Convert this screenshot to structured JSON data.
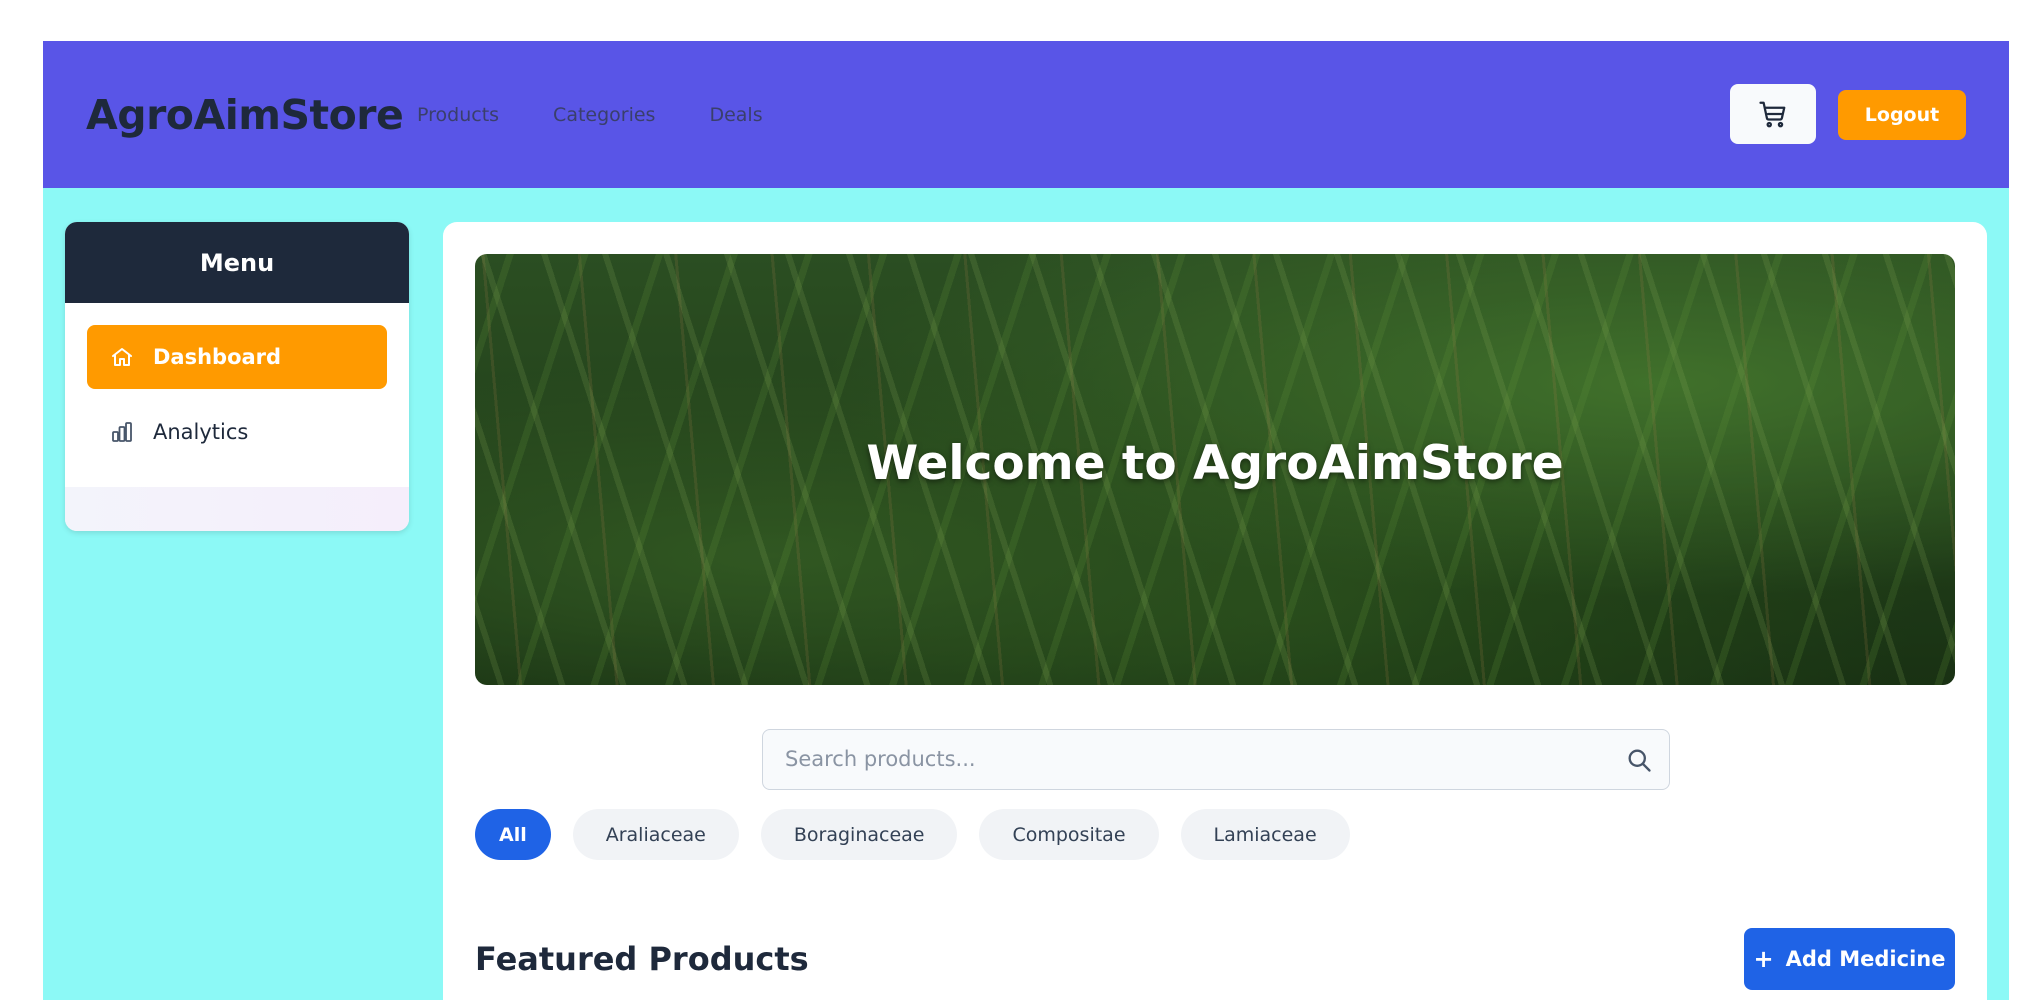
{
  "header": {
    "brand": "AgroAimStore",
    "nav": [
      {
        "label": "Products"
      },
      {
        "label": "Categories"
      },
      {
        "label": "Deals"
      }
    ],
    "cart_icon": "shopping-cart-icon",
    "logout_label": "Logout"
  },
  "sidebar": {
    "title": "Menu",
    "items": [
      {
        "label": "Dashboard",
        "icon": "home-icon",
        "active": true
      },
      {
        "label": "Analytics",
        "icon": "bar-chart-icon",
        "active": false
      }
    ]
  },
  "hero": {
    "title": "Welcome to AgroAimStore"
  },
  "search": {
    "placeholder": "Search products...",
    "value": ""
  },
  "filters": [
    {
      "label": "All",
      "active": true
    },
    {
      "label": "Araliaceae",
      "active": false
    },
    {
      "label": "Boraginaceae",
      "active": false
    },
    {
      "label": "Compositae",
      "active": false
    },
    {
      "label": "Lamiaceae",
      "active": false
    }
  ],
  "featured": {
    "title": "Featured Products",
    "add_label": "Add Medicine"
  },
  "colors": {
    "header_bg": "#5955e7",
    "page_bg": "#8cf9f6",
    "accent_orange": "#ff9a00",
    "accent_blue": "#1f63e6",
    "dark": "#1e293b"
  }
}
